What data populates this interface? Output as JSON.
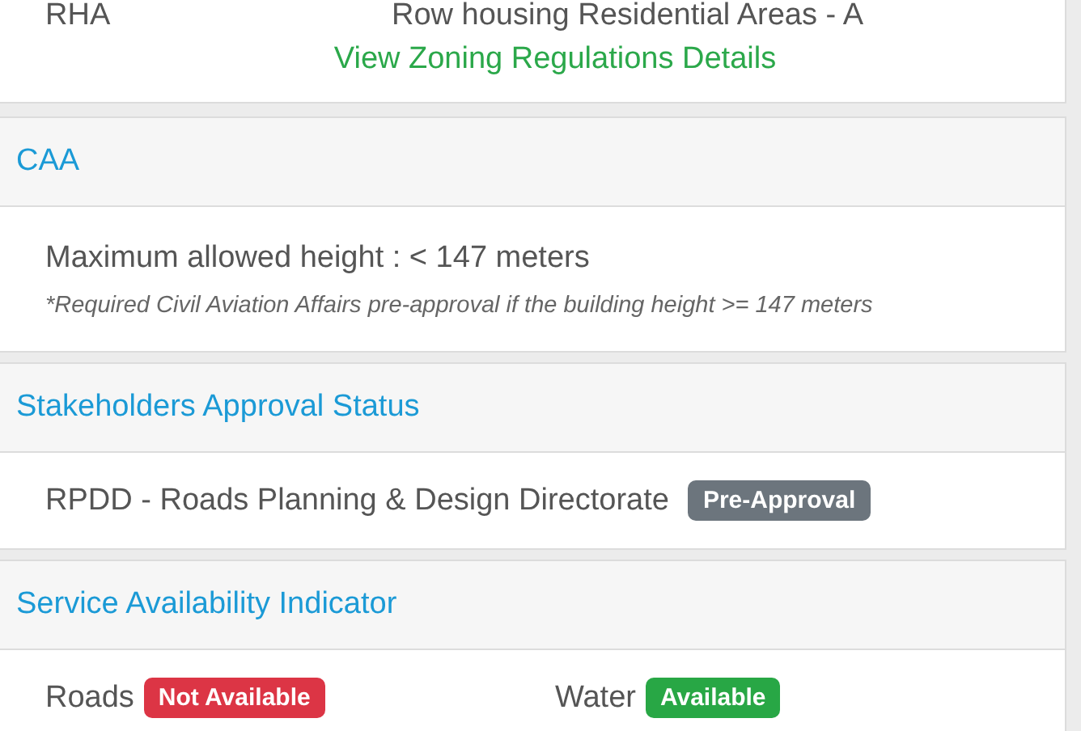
{
  "zoning": {
    "code": "RHA",
    "description": "Row housing Residential Areas - A",
    "link": "View Zoning Regulations Details"
  },
  "sections": [
    {
      "title": "CAA",
      "kind": "height",
      "text": "Maximum allowed height : < 147 meters",
      "note": "*Required Civil Aviation Affairs pre-approval if the building height >= 147 meters"
    },
    {
      "title": "Stakeholders Approval Status",
      "kind": "approvals",
      "items": [
        {
          "name": "RPDD - Roads Planning & Design Directorate",
          "status": "Pre-Approval",
          "color": "#6c757d"
        }
      ]
    },
    {
      "title": "Service Availability Indicator",
      "kind": "services",
      "items": [
        {
          "name": "Roads",
          "status": "Not Available",
          "color": "#dc3545"
        },
        {
          "name": "Water",
          "status": "Available",
          "color": "#28a745"
        }
      ]
    }
  ]
}
